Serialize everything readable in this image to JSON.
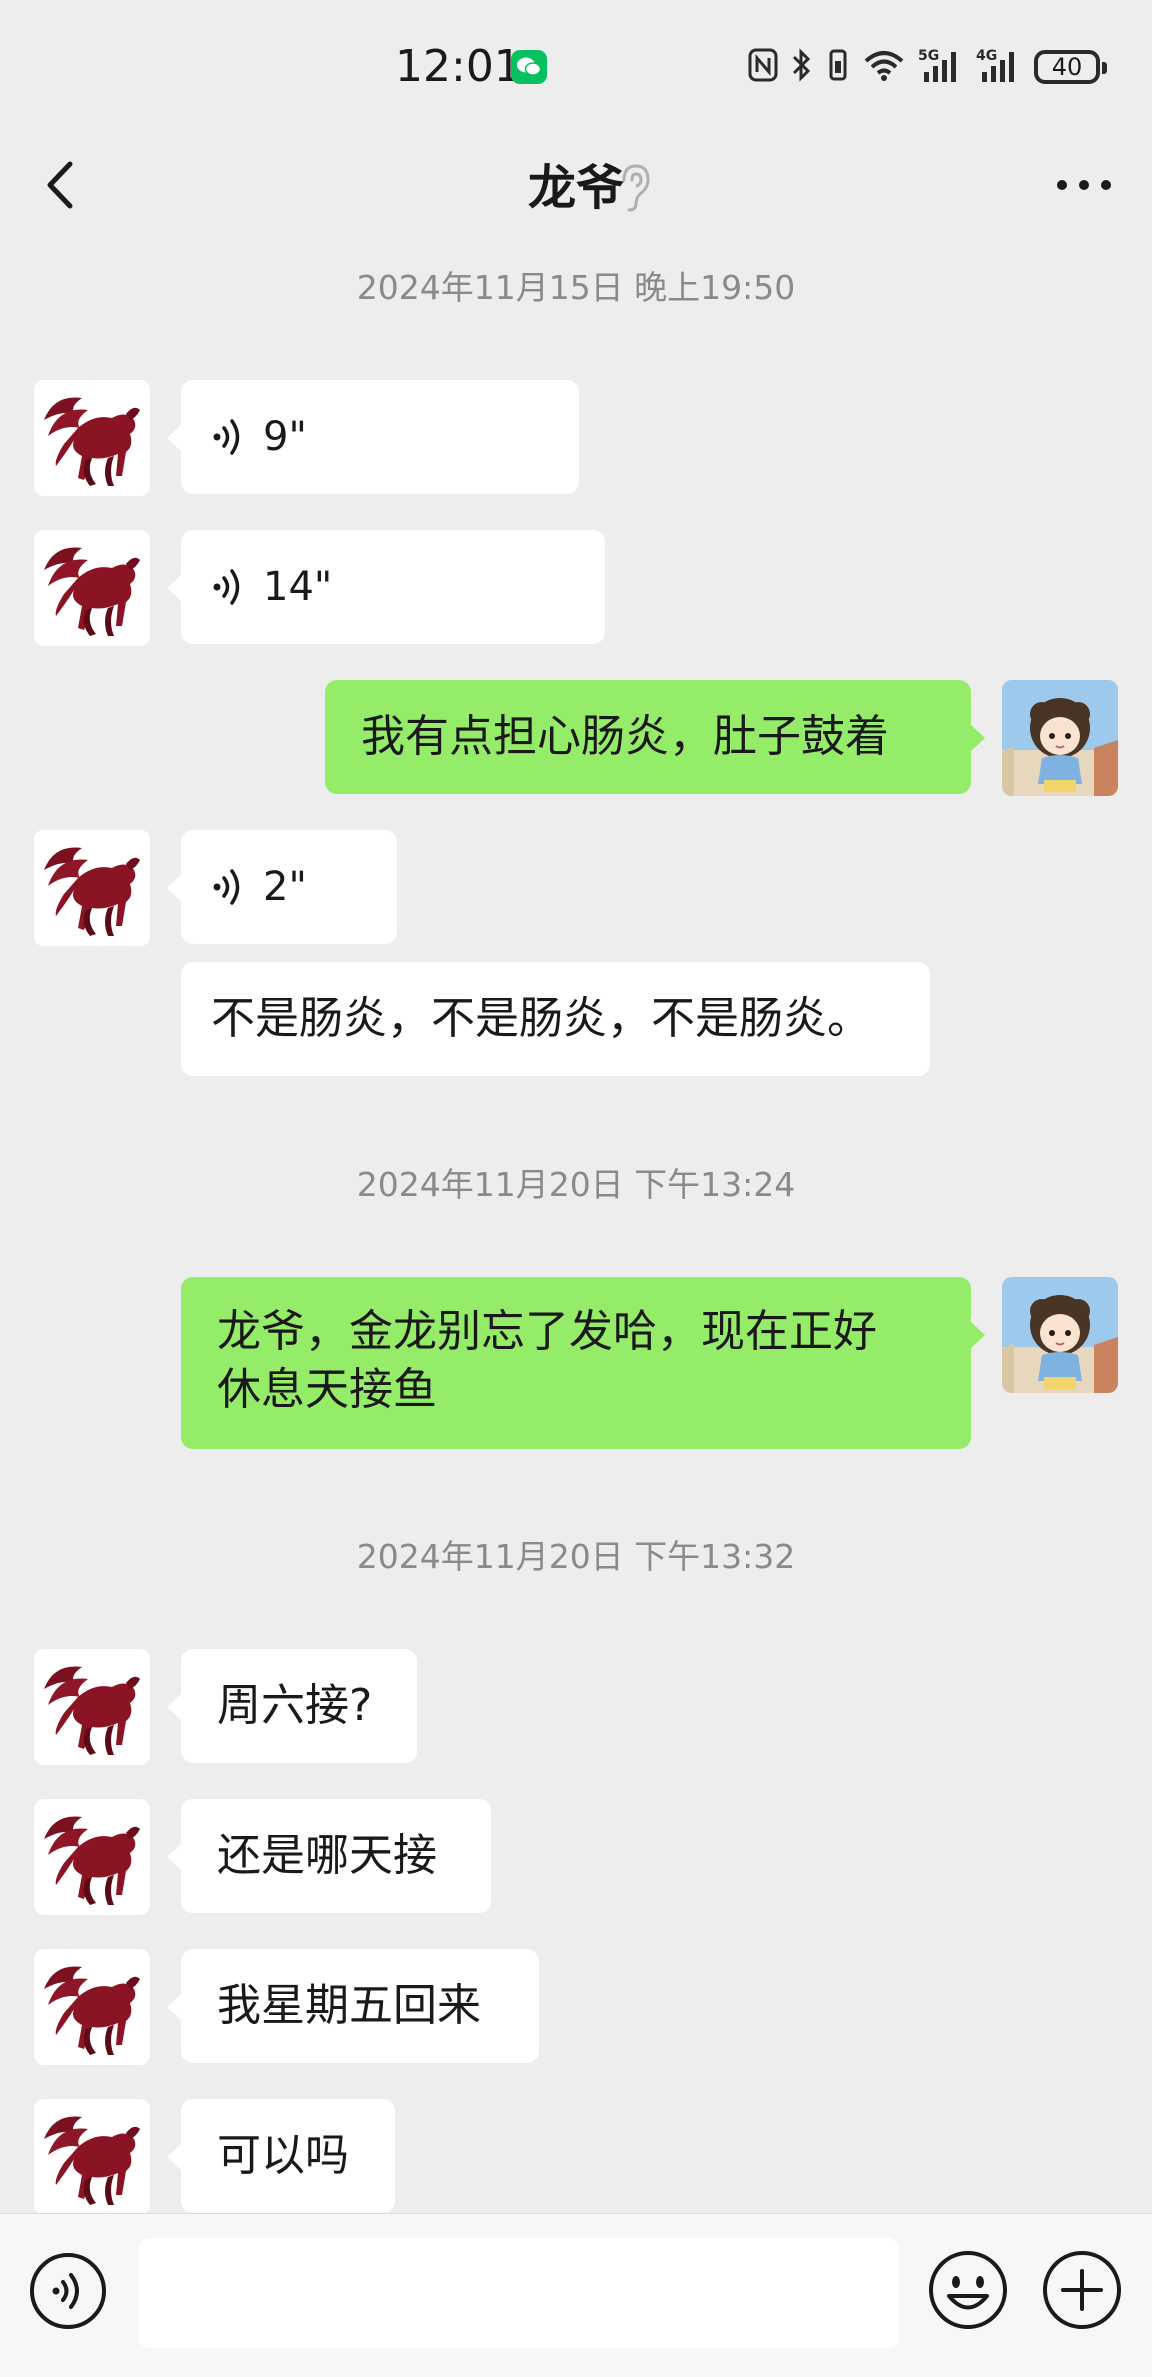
{
  "status_bar": {
    "time": "12:01",
    "battery": "40",
    "icons": [
      "wechat-icon",
      "nfc-icon",
      "bluetooth-icon",
      "vibrate-icon",
      "wifi-icon",
      "5g-signal-icon",
      "4g-signal-icon",
      "battery-icon"
    ]
  },
  "header": {
    "title": "龙爷",
    "back_icon": "chevron-left-icon",
    "ear_icon": "ear-icon",
    "more_icon": "more-icon"
  },
  "messages": [
    {
      "type": "timestamp",
      "text": "2024年11月15日 晚上19:50"
    },
    {
      "type": "voice",
      "side": "left",
      "duration": "9\""
    },
    {
      "type": "voice",
      "side": "left",
      "duration": "14\""
    },
    {
      "type": "text",
      "side": "right",
      "text": "我有点担心肠炎，肚子鼓着"
    },
    {
      "type": "voice",
      "side": "left",
      "duration": "2\""
    },
    {
      "type": "text",
      "side": "left",
      "text": "不是肠炎，不是肠炎，不是肠炎。"
    },
    {
      "type": "timestamp",
      "text": "2024年11月20日 下午13:24"
    },
    {
      "type": "text",
      "side": "right",
      "lines": [
        "龙爷，金龙别忘了发哈，现在正好",
        "休息天接鱼"
      ]
    },
    {
      "type": "timestamp",
      "text": "2024年11月20日 下午13:32"
    },
    {
      "type": "text",
      "side": "left",
      "text": "周六接?"
    },
    {
      "type": "text",
      "side": "left",
      "text": "还是哪天接"
    },
    {
      "type": "text",
      "side": "left",
      "text": "我星期五回来"
    },
    {
      "type": "text",
      "side": "left",
      "text": "可以吗"
    }
  ],
  "input_bar": {
    "placeholder": "",
    "voice_icon": "voice-input-icon",
    "emoji_icon": "emoji-icon",
    "plus_icon": "plus-icon"
  },
  "colors": {
    "background": "#ededed",
    "incoming_bubble": "#ffffff",
    "outgoing_bubble": "#95ec69",
    "timestamp_text": "#8a8a8a",
    "wechat_green": "#07c160"
  }
}
